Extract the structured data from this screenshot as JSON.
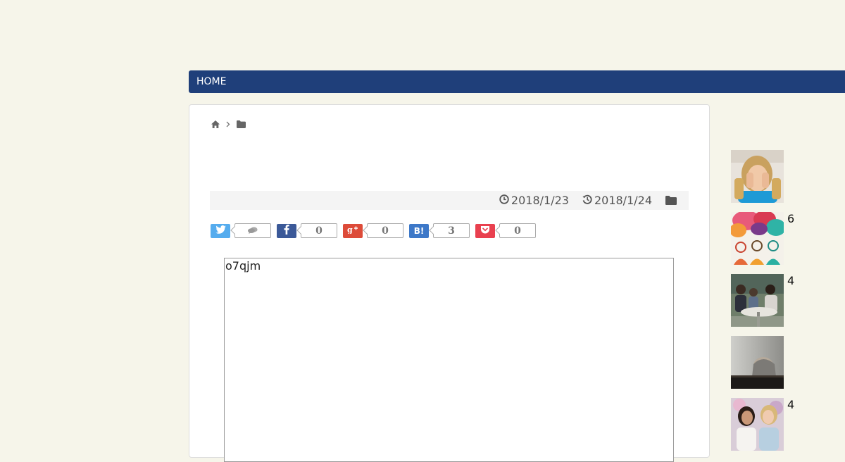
{
  "nav": {
    "home_label": "HOME"
  },
  "breadcrumb": {
    "icons": [
      "home-icon",
      "chevron-right-icon",
      "folder-icon"
    ]
  },
  "meta": {
    "published_date": "2018/1/23",
    "updated_date": "2018/1/24",
    "icons": [
      "clock-icon",
      "history-icon",
      "folder-icon"
    ]
  },
  "share": {
    "twitter": {
      "count": ""
    },
    "facebook": {
      "count": "0"
    },
    "googleplus": {
      "count": "0"
    },
    "hatena": {
      "label": "B!",
      "count": "3"
    },
    "pocket": {
      "count": "0"
    }
  },
  "textbox": {
    "value": "o7qjm"
  },
  "sidebar": {
    "items": [
      {
        "number": "",
        "thumb": "girl-covering-face"
      },
      {
        "number": "6",
        "thumb": "speech-bubbles-people"
      },
      {
        "number": "4",
        "thumb": "people-at-cafe-table"
      },
      {
        "number": "",
        "thumb": "person-head-on-table"
      },
      {
        "number": "4",
        "thumb": "two-women-talking"
      }
    ]
  },
  "colors": {
    "background": "#f6f5ea",
    "nav": "#1f3f7a",
    "twitter": "#55acee",
    "facebook": "#3b5998",
    "googleplus": "#dd4b39",
    "hatena": "#3d78c8",
    "pocket": "#e9404f"
  }
}
